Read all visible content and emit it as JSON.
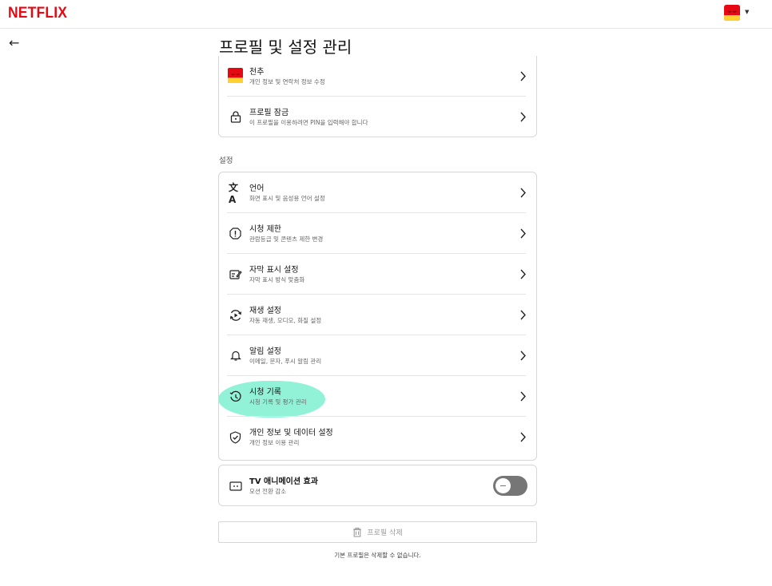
{
  "header": {
    "logo": "NETFLIX",
    "avatar_color": "#e50914"
  },
  "page": {
    "back_icon": "arrow-left-icon",
    "title": "프로필 및 설정 관리"
  },
  "profile_section": {
    "items": [
      {
        "title": "천추",
        "subtitle": "개인 정보 및 연락처 정보 수정",
        "icon": "profile-avatar-icon"
      },
      {
        "title": "프로필 잠금",
        "subtitle": "이 프로필을 이용하려면 PIN을 입력해야 합니다",
        "icon": "lock-icon"
      }
    ]
  },
  "settings": {
    "label": "설정",
    "items": [
      {
        "title": "언어",
        "subtitle": "화면 표시 및 음성용 언어 설정",
        "icon": "language-icon"
      },
      {
        "title": "시청 제한",
        "subtitle": "관람등급 및 콘텐츠 제한 변경",
        "icon": "restriction-icon"
      },
      {
        "title": "자막 표시 설정",
        "subtitle": "자막 표시 방식 맞춤화",
        "icon": "subtitles-icon"
      },
      {
        "title": "재생 설정",
        "subtitle": "자동 재생, 오디오, 화질 설정",
        "icon": "playback-icon"
      },
      {
        "title": "알림 설정",
        "subtitle": "이메일, 문자, 푸시 알림 관리",
        "icon": "bell-icon"
      },
      {
        "title": "시청 기록",
        "subtitle": "시청 기록 및 평가 관리",
        "icon": "history-icon"
      },
      {
        "title": "개인 정보 및 데이터 설정",
        "subtitle": "개인 정보 이용 관리",
        "icon": "shield-check-icon"
      }
    ]
  },
  "tv_animation": {
    "title": "TV 애니메이션 효과",
    "subtitle": "모션 전환 감소",
    "icon": "tv-icon",
    "enabled": false
  },
  "delete": {
    "label": "프로필 삭제",
    "icon": "trash-icon",
    "note": "기본 프로필은 삭제할 수 없습니다."
  },
  "colors": {
    "brand": "#e50914",
    "highlight": "#7ff0d0",
    "toggle_off": "#767676"
  }
}
